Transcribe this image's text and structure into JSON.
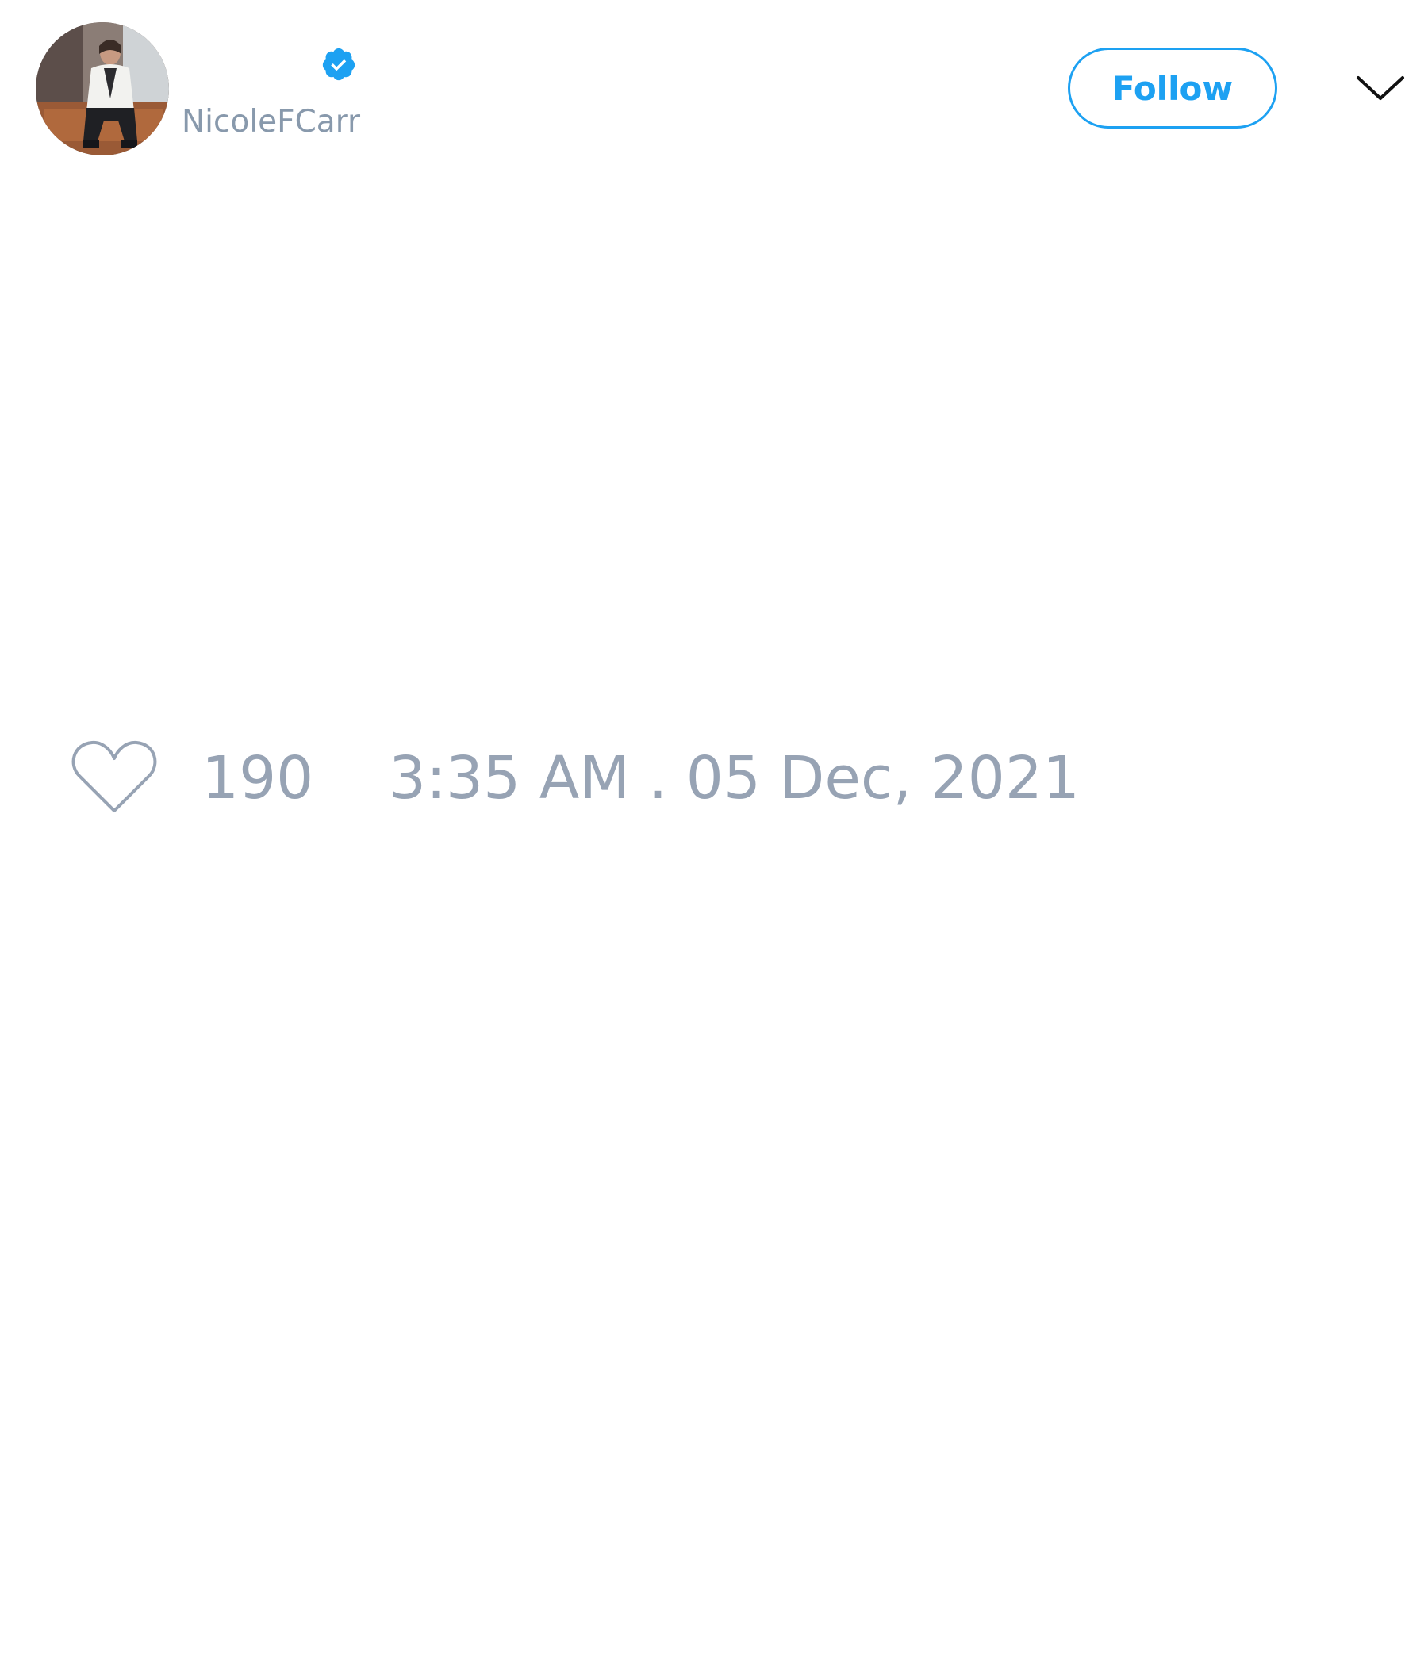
{
  "tweet": {
    "author": {
      "handle": "NicoleFCarr",
      "verified": true,
      "avatar": "profile-photo"
    },
    "follow_label": "Follow",
    "menu_icon": "chevron-down-icon",
    "like_icon": "heart-icon",
    "like_count": "190",
    "timestamp": "3:35 AM . 05 Dec, 2021"
  },
  "colors": {
    "accent": "#1da1f2",
    "muted_text": "#8899ac",
    "meta_text": "#97a3b4",
    "background": "#ffffff"
  }
}
